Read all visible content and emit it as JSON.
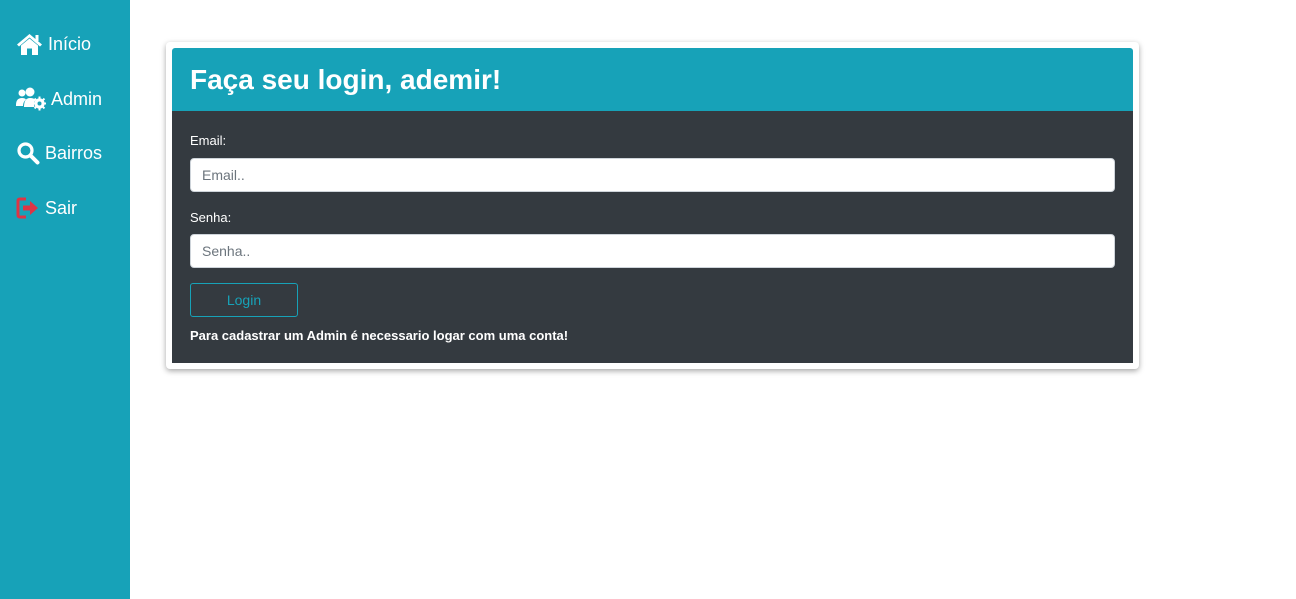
{
  "sidebar": {
    "items": [
      {
        "label": "Início",
        "icon": "home-icon"
      },
      {
        "label": "Admin",
        "icon": "users-cog-icon"
      },
      {
        "label": "Bairros",
        "icon": "search-icon"
      },
      {
        "label": "Sair",
        "icon": "sign-out-icon"
      }
    ]
  },
  "login": {
    "title": "Faça seu login, ademir!",
    "email_label": "Email:",
    "email_placeholder": "Email..",
    "email_value": "",
    "senha_label": "Senha:",
    "senha_placeholder": "Senha..",
    "senha_value": "",
    "button_label": "Login",
    "note": "Para cadastrar um Admin é necessario logar com uma conta!"
  },
  "colors": {
    "accent": "#17a2b8",
    "panel": "#343a40",
    "logout_icon": "#dc3545"
  }
}
